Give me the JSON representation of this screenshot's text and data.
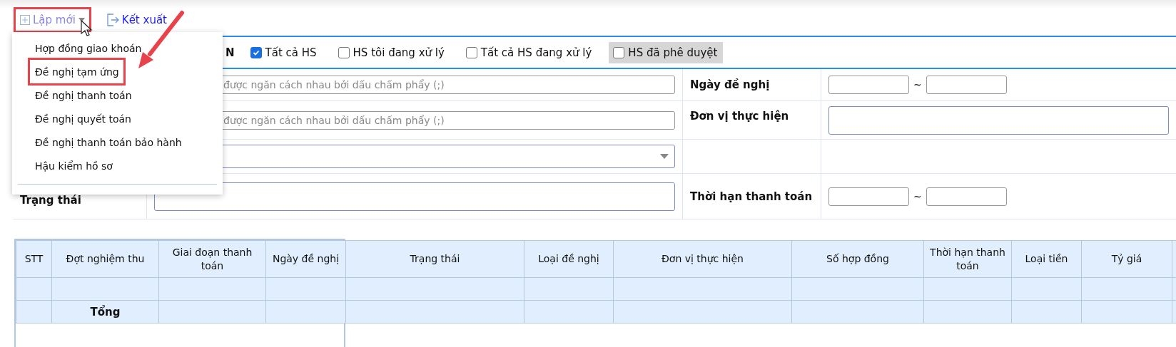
{
  "toolbar": {
    "buttons": [
      {
        "kind": "new",
        "label": "Lập mới",
        "annotated": true
      },
      {
        "kind": "export",
        "label": "Kết xuất",
        "annotated": false
      }
    ]
  },
  "menu": {
    "items": [
      {
        "label": "Hợp đồng giao khoán",
        "annotated": false
      },
      {
        "label": "Đề nghị tạm ứng",
        "annotated": true
      },
      {
        "label": "Đề nghị thanh toán",
        "annotated": false
      },
      {
        "label": "Đề nghị quyết toán",
        "annotated": false
      },
      {
        "label": "Đề nghị thanh toán bảo hành",
        "annotated": false
      },
      {
        "label": "Hậu kiểm hồ sơ",
        "annotated": false
      }
    ]
  },
  "filters": {
    "label": "N",
    "checkboxes": [
      {
        "label": "Tất cả HS",
        "checked": true,
        "highlighted": false
      },
      {
        "label": "HS tôi đang xử lý",
        "checked": false,
        "highlighted": false
      },
      {
        "label": "Tất cả HS đang xử lý",
        "checked": false,
        "highlighted": false
      },
      {
        "label": "HS đã phê duyệt",
        "checked": false,
        "highlighted": true
      }
    ]
  },
  "form": {
    "rows": [
      {
        "left": {
          "kind": "text",
          "placeholder": "được ngăn cách nhau bởi dấu chấm phẩy (;)"
        },
        "right": {
          "label": "Ngày đề nghị",
          "kind": "date_range",
          "separator": "~"
        }
      },
      {
        "left": {
          "kind": "text",
          "placeholder": "được ngăn cách nhau bởi dấu chấm phẩy (;)"
        },
        "right": {
          "label": "Đơn vị thực hiện",
          "kind": "textarea"
        }
      },
      {
        "left": {
          "kind": "select"
        }
      },
      {
        "label": "Trạng thái",
        "left": {
          "kind": "textarea"
        },
        "right": {
          "label": "Thời hạn thanh toán",
          "kind": "date_range",
          "separator": "~"
        }
      }
    ]
  },
  "table": {
    "frozen_columns": [
      "STT",
      "Đợt nghiệm thu",
      "Giai đoạn thanh toán",
      "Ngày đề nghị"
    ],
    "columns": [
      "Trạng thái",
      "Loại đề nghị",
      "Đơn vị thực hiện",
      "Số hợp đồng",
      "Thời hạn thanh toán",
      "Loại tiền",
      "Tỷ giá"
    ],
    "rows": [
      {
        "kind": "blank"
      },
      {
        "kind": "total",
        "label": "Tổng"
      }
    ]
  }
}
